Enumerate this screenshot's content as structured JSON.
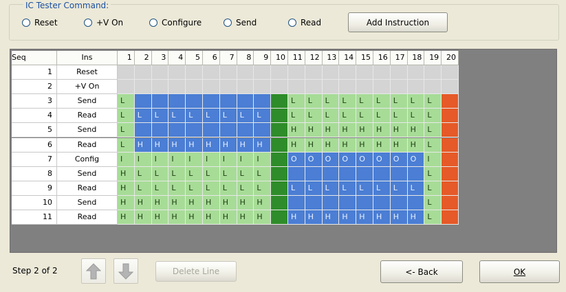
{
  "command_group": {
    "title": "IC Tester Command:",
    "radios": [
      {
        "label": "Reset"
      },
      {
        "label": "+V On"
      },
      {
        "label": "Configure"
      },
      {
        "label": "Send"
      },
      {
        "label": "Read"
      }
    ],
    "add_button": "Add Instruction"
  },
  "grid": {
    "headers": [
      "Seq",
      "Ins",
      "1",
      "2",
      "3",
      "4",
      "5",
      "6",
      "7",
      "8",
      "9",
      "10",
      "11",
      "12",
      "13",
      "14",
      "15",
      "16",
      "17",
      "18",
      "19",
      "20"
    ],
    "rows": [
      {
        "seq": "1",
        "ins": "Reset",
        "cells": [
          [
            "gr",
            ""
          ],
          [
            "gr",
            ""
          ],
          [
            "gr",
            ""
          ],
          [
            "gr",
            ""
          ],
          [
            "gr",
            ""
          ],
          [
            "gr",
            ""
          ],
          [
            "gr",
            ""
          ],
          [
            "gr",
            ""
          ],
          [
            "gr",
            ""
          ],
          [
            "gr",
            ""
          ],
          [
            "gr",
            ""
          ],
          [
            "gr",
            ""
          ],
          [
            "gr",
            ""
          ],
          [
            "gr",
            ""
          ],
          [
            "gr",
            ""
          ],
          [
            "gr",
            ""
          ],
          [
            "gr",
            ""
          ],
          [
            "gr",
            ""
          ],
          [
            "gr",
            ""
          ],
          [
            "gr",
            ""
          ]
        ]
      },
      {
        "seq": "2",
        "ins": "+V On",
        "cells": [
          [
            "gr",
            ""
          ],
          [
            "gr",
            ""
          ],
          [
            "gr",
            ""
          ],
          [
            "gr",
            ""
          ],
          [
            "gr",
            ""
          ],
          [
            "gr",
            ""
          ],
          [
            "gr",
            ""
          ],
          [
            "gr",
            ""
          ],
          [
            "gr",
            ""
          ],
          [
            "gr",
            ""
          ],
          [
            "gr",
            ""
          ],
          [
            "gr",
            ""
          ],
          [
            "gr",
            ""
          ],
          [
            "gr",
            ""
          ],
          [
            "gr",
            ""
          ],
          [
            "gr",
            ""
          ],
          [
            "gr",
            ""
          ],
          [
            "gr",
            ""
          ],
          [
            "gr",
            ""
          ],
          [
            "gr",
            ""
          ]
        ]
      },
      {
        "seq": "3",
        "ins": "Send",
        "cells": [
          [
            "g",
            "L"
          ],
          [
            "b",
            ""
          ],
          [
            "b",
            ""
          ],
          [
            "b",
            ""
          ],
          [
            "b",
            ""
          ],
          [
            "b",
            ""
          ],
          [
            "b",
            ""
          ],
          [
            "b",
            ""
          ],
          [
            "b",
            ""
          ],
          [
            "dg",
            ""
          ],
          [
            "g",
            "L"
          ],
          [
            "g",
            "L"
          ],
          [
            "g",
            "L"
          ],
          [
            "g",
            "L"
          ],
          [
            "g",
            "L"
          ],
          [
            "g",
            "L"
          ],
          [
            "g",
            "L"
          ],
          [
            "g",
            "L"
          ],
          [
            "g",
            "L"
          ],
          [
            "r",
            ""
          ]
        ]
      },
      {
        "seq": "4",
        "ins": "Read",
        "cells": [
          [
            "g",
            "L"
          ],
          [
            "b",
            "L"
          ],
          [
            "b",
            "L"
          ],
          [
            "b",
            "L"
          ],
          [
            "b",
            "L"
          ],
          [
            "b",
            "L"
          ],
          [
            "b",
            "L"
          ],
          [
            "b",
            "L"
          ],
          [
            "b",
            "L"
          ],
          [
            "dg",
            ""
          ],
          [
            "g",
            "L"
          ],
          [
            "g",
            "L"
          ],
          [
            "g",
            "L"
          ],
          [
            "g",
            "L"
          ],
          [
            "g",
            "L"
          ],
          [
            "g",
            "L"
          ],
          [
            "g",
            "L"
          ],
          [
            "g",
            "L"
          ],
          [
            "g",
            "L"
          ],
          [
            "r",
            ""
          ]
        ]
      },
      {
        "seq": "5",
        "ins": "Send",
        "cells": [
          [
            "g",
            "L"
          ],
          [
            "b",
            ""
          ],
          [
            "b",
            ""
          ],
          [
            "b",
            ""
          ],
          [
            "b",
            ""
          ],
          [
            "b",
            ""
          ],
          [
            "b",
            ""
          ],
          [
            "b",
            ""
          ],
          [
            "b",
            ""
          ],
          [
            "dg",
            ""
          ],
          [
            "g",
            "H"
          ],
          [
            "g",
            "H"
          ],
          [
            "g",
            "H"
          ],
          [
            "g",
            "H"
          ],
          [
            "g",
            "H"
          ],
          [
            "g",
            "H"
          ],
          [
            "g",
            "H"
          ],
          [
            "g",
            "H"
          ],
          [
            "g",
            "L"
          ],
          [
            "r",
            ""
          ]
        ]
      },
      {
        "seq": "6",
        "ins": "Read",
        "cells": [
          [
            "g",
            "L"
          ],
          [
            "b",
            "H"
          ],
          [
            "b",
            "H"
          ],
          [
            "b",
            "H"
          ],
          [
            "b",
            "H"
          ],
          [
            "b",
            "H"
          ],
          [
            "b",
            "H"
          ],
          [
            "b",
            "H"
          ],
          [
            "b",
            "H"
          ],
          [
            "dg",
            ""
          ],
          [
            "g",
            "H"
          ],
          [
            "g",
            "H"
          ],
          [
            "g",
            "H"
          ],
          [
            "g",
            "H"
          ],
          [
            "g",
            "H"
          ],
          [
            "g",
            "H"
          ],
          [
            "g",
            "H"
          ],
          [
            "g",
            "H"
          ],
          [
            "g",
            "L"
          ],
          [
            "r",
            ""
          ]
        ]
      },
      {
        "seq": "7",
        "ins": "Config",
        "cells": [
          [
            "g",
            "I"
          ],
          [
            "g",
            "I"
          ],
          [
            "g",
            "I"
          ],
          [
            "g",
            "I"
          ],
          [
            "g",
            "I"
          ],
          [
            "g",
            "I"
          ],
          [
            "g",
            "I"
          ],
          [
            "g",
            "I"
          ],
          [
            "g",
            "I"
          ],
          [
            "dg",
            ""
          ],
          [
            "b",
            "O"
          ],
          [
            "b",
            "O"
          ],
          [
            "b",
            "O"
          ],
          [
            "b",
            "O"
          ],
          [
            "b",
            "O"
          ],
          [
            "b",
            "O"
          ],
          [
            "b",
            "O"
          ],
          [
            "b",
            "O"
          ],
          [
            "g",
            "I"
          ],
          [
            "r",
            ""
          ]
        ]
      },
      {
        "seq": "8",
        "ins": "Send",
        "cells": [
          [
            "g",
            "H"
          ],
          [
            "g",
            "L"
          ],
          [
            "g",
            "L"
          ],
          [
            "g",
            "L"
          ],
          [
            "g",
            "L"
          ],
          [
            "g",
            "L"
          ],
          [
            "g",
            "L"
          ],
          [
            "g",
            "L"
          ],
          [
            "g",
            "L"
          ],
          [
            "dg",
            ""
          ],
          [
            "b",
            ""
          ],
          [
            "b",
            ""
          ],
          [
            "b",
            ""
          ],
          [
            "b",
            ""
          ],
          [
            "b",
            ""
          ],
          [
            "b",
            ""
          ],
          [
            "b",
            ""
          ],
          [
            "b",
            ""
          ],
          [
            "g",
            "L"
          ],
          [
            "r",
            ""
          ]
        ]
      },
      {
        "seq": "9",
        "ins": "Read",
        "cells": [
          [
            "g",
            "H"
          ],
          [
            "g",
            "L"
          ],
          [
            "g",
            "L"
          ],
          [
            "g",
            "L"
          ],
          [
            "g",
            "L"
          ],
          [
            "g",
            "L"
          ],
          [
            "g",
            "L"
          ],
          [
            "g",
            "L"
          ],
          [
            "g",
            "L"
          ],
          [
            "dg",
            ""
          ],
          [
            "b",
            "L"
          ],
          [
            "b",
            "L"
          ],
          [
            "b",
            "L"
          ],
          [
            "b",
            "L"
          ],
          [
            "b",
            "L"
          ],
          [
            "b",
            "L"
          ],
          [
            "b",
            "L"
          ],
          [
            "b",
            "L"
          ],
          [
            "g",
            "L"
          ],
          [
            "r",
            ""
          ]
        ]
      },
      {
        "seq": "10",
        "ins": "Send",
        "cells": [
          [
            "g",
            "H"
          ],
          [
            "g",
            "H"
          ],
          [
            "g",
            "H"
          ],
          [
            "g",
            "H"
          ],
          [
            "g",
            "H"
          ],
          [
            "g",
            "H"
          ],
          [
            "g",
            "H"
          ],
          [
            "g",
            "H"
          ],
          [
            "g",
            "H"
          ],
          [
            "dg",
            ""
          ],
          [
            "b",
            ""
          ],
          [
            "b",
            ""
          ],
          [
            "b",
            ""
          ],
          [
            "b",
            ""
          ],
          [
            "b",
            ""
          ],
          [
            "b",
            ""
          ],
          [
            "b",
            ""
          ],
          [
            "b",
            ""
          ],
          [
            "g",
            "L"
          ],
          [
            "r",
            ""
          ]
        ]
      },
      {
        "seq": "11",
        "ins": "Read",
        "cells": [
          [
            "g",
            "H"
          ],
          [
            "g",
            "H"
          ],
          [
            "g",
            "H"
          ],
          [
            "g",
            "H"
          ],
          [
            "g",
            "H"
          ],
          [
            "g",
            "H"
          ],
          [
            "g",
            "H"
          ],
          [
            "g",
            "H"
          ],
          [
            "g",
            "H"
          ],
          [
            "dg",
            ""
          ],
          [
            "b",
            "H"
          ],
          [
            "b",
            "H"
          ],
          [
            "b",
            "H"
          ],
          [
            "b",
            "H"
          ],
          [
            "b",
            "H"
          ],
          [
            "b",
            "H"
          ],
          [
            "b",
            "H"
          ],
          [
            "b",
            "H"
          ],
          [
            "g",
            "L"
          ],
          [
            "r",
            ""
          ]
        ]
      }
    ]
  },
  "footer": {
    "step_label": "Step 2 of 2",
    "up_icon": "arrow-up-icon",
    "down_icon": "arrow-down-icon",
    "delete_button": "Delete Line",
    "back_button": "<- Back",
    "ok_button": "OK"
  },
  "colors": {
    "pin_green": "#a7dc97",
    "pin_blue": "#4b7ed4",
    "ground_green": "#2f8c2a",
    "vcc_red": "#e55a28",
    "idle_gray": "#d4d4d4",
    "window_bg": "#ece9d8"
  }
}
